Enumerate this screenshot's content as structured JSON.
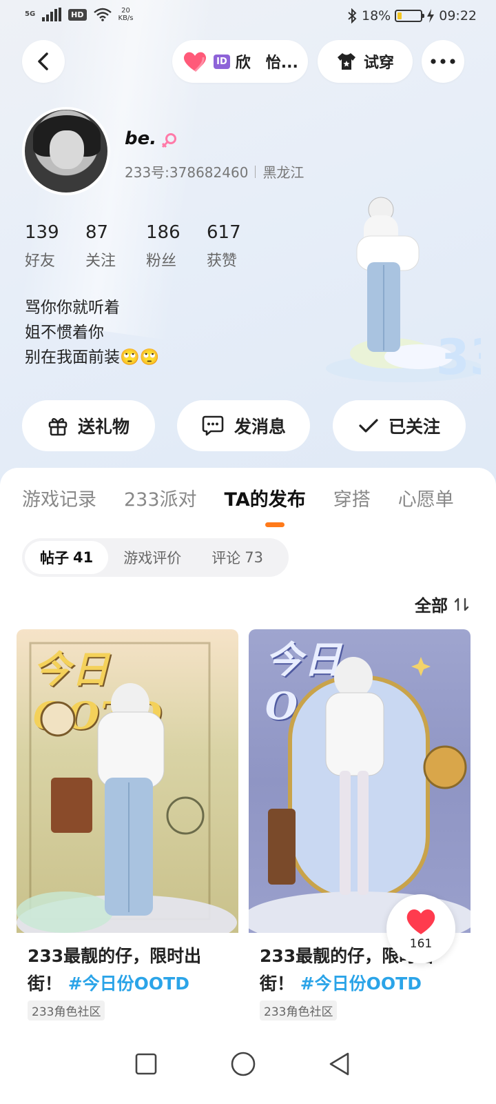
{
  "status_bar": {
    "network": "5G",
    "hd": "HD",
    "speed_value": "20",
    "speed_unit": "KB/s",
    "battery": "18%",
    "battery_level": 0.18,
    "time": "09:22"
  },
  "header": {
    "name_chip_badge": "ID",
    "name_chip_text": "欣　怡...",
    "tryon_label": "试穿"
  },
  "profile": {
    "username": "be.",
    "account": "233号:378682460",
    "location": "黑龙江",
    "stats": [
      {
        "value": "139",
        "label": "好友"
      },
      {
        "value": "87",
        "label": "关注"
      },
      {
        "value": "186",
        "label": "粉丝"
      },
      {
        "value": "617",
        "label": "获赞"
      }
    ],
    "bio": [
      "骂你你就听着",
      "姐不惯着你",
      "别在我面前装🙄🙄"
    ]
  },
  "actions": {
    "gift": "送礼物",
    "message": "发消息",
    "followed": "已关注"
  },
  "tabs": [
    "游戏记录",
    "233派对",
    "TA的发布",
    "穿搭",
    "心愿单"
  ],
  "active_tab": "TA的发布",
  "subtabs": [
    {
      "label": "帖子",
      "count": "41"
    },
    {
      "label": "游戏评价",
      "count": ""
    },
    {
      "label": "评论",
      "count": "73"
    }
  ],
  "sort_label": "全部",
  "posts": [
    {
      "image_text": "今日OOTD",
      "title": "233最靓的仔，限时出街！",
      "hashtag": "#今日份OOTD",
      "community": "233角色社区"
    },
    {
      "image_text": "今日OOTD",
      "title": "233最靓的仔，限时出街！",
      "hashtag": "#今日份OOTD",
      "community": "233角色社区"
    }
  ],
  "like_count": "161",
  "colors": {
    "accent": "#ff7a1a",
    "hashtag": "#2ba4e8",
    "heart": "#ff3b4e"
  }
}
